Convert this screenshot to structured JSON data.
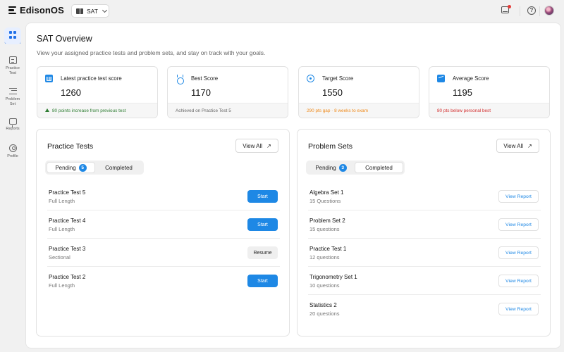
{
  "app": {
    "name": "EdisonOS"
  },
  "exam_selector": {
    "value": "SAT"
  },
  "sidebar": {
    "items": [
      {
        "label": "Overview",
        "icon": "grid-icon",
        "active": true
      },
      {
        "label": "Practice Test",
        "icon": "document-icon"
      },
      {
        "label": "Problem Set",
        "icon": "checklist-icon"
      },
      {
        "label": "Reports",
        "icon": "board-icon"
      },
      {
        "label": "Profile",
        "icon": "user-icon"
      }
    ]
  },
  "header": {
    "help_symbol": "?"
  },
  "page": {
    "title": "SAT Overview",
    "subtitle": "View your assigned practice tests and problem sets, and stay on track with your goals."
  },
  "stats": [
    {
      "label": "Latest practice test score",
      "value": "1260",
      "footer": "80 points increase from previous test",
      "footer_color": "#2e7d32",
      "icon": "bar-chart-icon"
    },
    {
      "label": "Best Score",
      "value": "1170",
      "footer": "Achieved on Practice Test 5",
      "footer_color": "#666666",
      "icon": "medal-icon"
    },
    {
      "label": "Target Score",
      "value": "1550",
      "footer": "290 pts gap · 8 weeks to exam",
      "footer_color": "#ef8a1b",
      "icon": "target-icon"
    },
    {
      "label": "Average Score",
      "value": "1195",
      "footer": "80 pts below personal best",
      "footer_color": "#d32f2f",
      "icon": "trend-icon"
    }
  ],
  "practice_tests": {
    "title": "Practice Tests",
    "view_all": "View All",
    "tabs": {
      "pending": "Pending",
      "pending_count": "5",
      "completed": "Completed"
    },
    "rows": [
      {
        "name": "Practice Test 5",
        "sub": "Full Length",
        "action": "Start"
      },
      {
        "name": "Practice Test 4",
        "sub": "Full Length",
        "action": "Start"
      },
      {
        "name": "Practice Test 3",
        "sub": "Sectional",
        "action": "Resume"
      },
      {
        "name": "Practice Test 2",
        "sub": "Full Length",
        "action": "Start"
      }
    ]
  },
  "problem_sets": {
    "title": "Problem Sets",
    "view_all": "View All",
    "tabs": {
      "pending": "Pending",
      "pending_count": "3",
      "completed": "Completed"
    },
    "rows": [
      {
        "name": "Algebra Set 1",
        "sub": "15 Questions",
        "action": "View Report"
      },
      {
        "name": "Problem Set 2",
        "sub": "15 questions",
        "action": "View Report"
      },
      {
        "name": "Practice Test 1",
        "sub": "12 questions",
        "action": "View Report"
      },
      {
        "name": "Trigonometry Set 1",
        "sub": "10 questions",
        "action": "View Report"
      },
      {
        "name": "Statistics 2",
        "sub": "20 questions",
        "action": "View Report"
      }
    ]
  }
}
